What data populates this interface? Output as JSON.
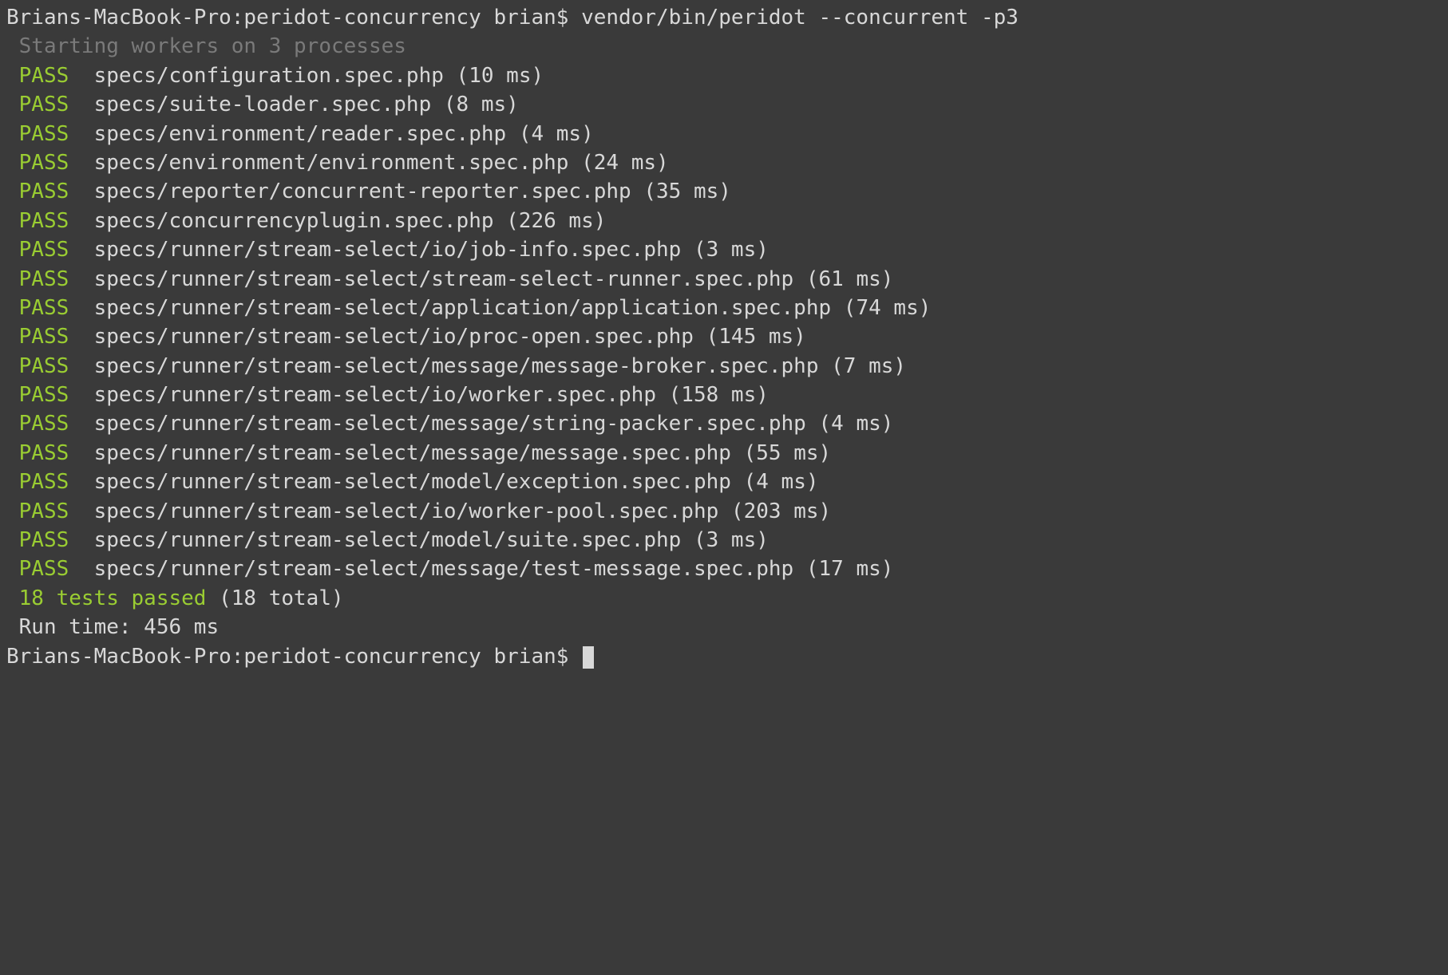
{
  "prompt1": {
    "host": "Brians-MacBook-Pro:peridot-concurrency brian$",
    "command": "vendor/bin/peridot --concurrent -p3"
  },
  "startup": " Starting workers on 3 processes",
  "pass_label": " PASS",
  "results": [
    {
      "file": "specs/configuration.spec.php",
      "time": "(10 ms)"
    },
    {
      "file": "specs/suite-loader.spec.php",
      "time": "(8 ms)"
    },
    {
      "file": "specs/environment/reader.spec.php",
      "time": "(4 ms)"
    },
    {
      "file": "specs/environment/environment.spec.php",
      "time": "(24 ms)"
    },
    {
      "file": "specs/reporter/concurrent-reporter.spec.php",
      "time": "(35 ms)"
    },
    {
      "file": "specs/concurrencyplugin.spec.php",
      "time": "(226 ms)"
    },
    {
      "file": "specs/runner/stream-select/io/job-info.spec.php",
      "time": "(3 ms)"
    },
    {
      "file": "specs/runner/stream-select/stream-select-runner.spec.php",
      "time": "(61 ms)"
    },
    {
      "file": "specs/runner/stream-select/application/application.spec.php",
      "time": "(74 ms)"
    },
    {
      "file": "specs/runner/stream-select/io/proc-open.spec.php",
      "time": "(145 ms)"
    },
    {
      "file": "specs/runner/stream-select/message/message-broker.spec.php",
      "time": "(7 ms)"
    },
    {
      "file": "specs/runner/stream-select/io/worker.spec.php",
      "time": "(158 ms)"
    },
    {
      "file": "specs/runner/stream-select/message/string-packer.spec.php",
      "time": "(4 ms)"
    },
    {
      "file": "specs/runner/stream-select/message/message.spec.php",
      "time": "(55 ms)"
    },
    {
      "file": "specs/runner/stream-select/model/exception.spec.php",
      "time": "(4 ms)"
    },
    {
      "file": "specs/runner/stream-select/io/worker-pool.spec.php",
      "time": "(203 ms)"
    },
    {
      "file": "specs/runner/stream-select/model/suite.spec.php",
      "time": "(3 ms)"
    },
    {
      "file": "specs/runner/stream-select/message/test-message.spec.php",
      "time": "(17 ms)"
    }
  ],
  "summary": {
    "passed": " 18 tests passed",
    "total": " (18 total)"
  },
  "runtime": " Run time: 456 ms",
  "prompt2": {
    "host": "Brians-MacBook-Pro:peridot-concurrency brian$"
  }
}
